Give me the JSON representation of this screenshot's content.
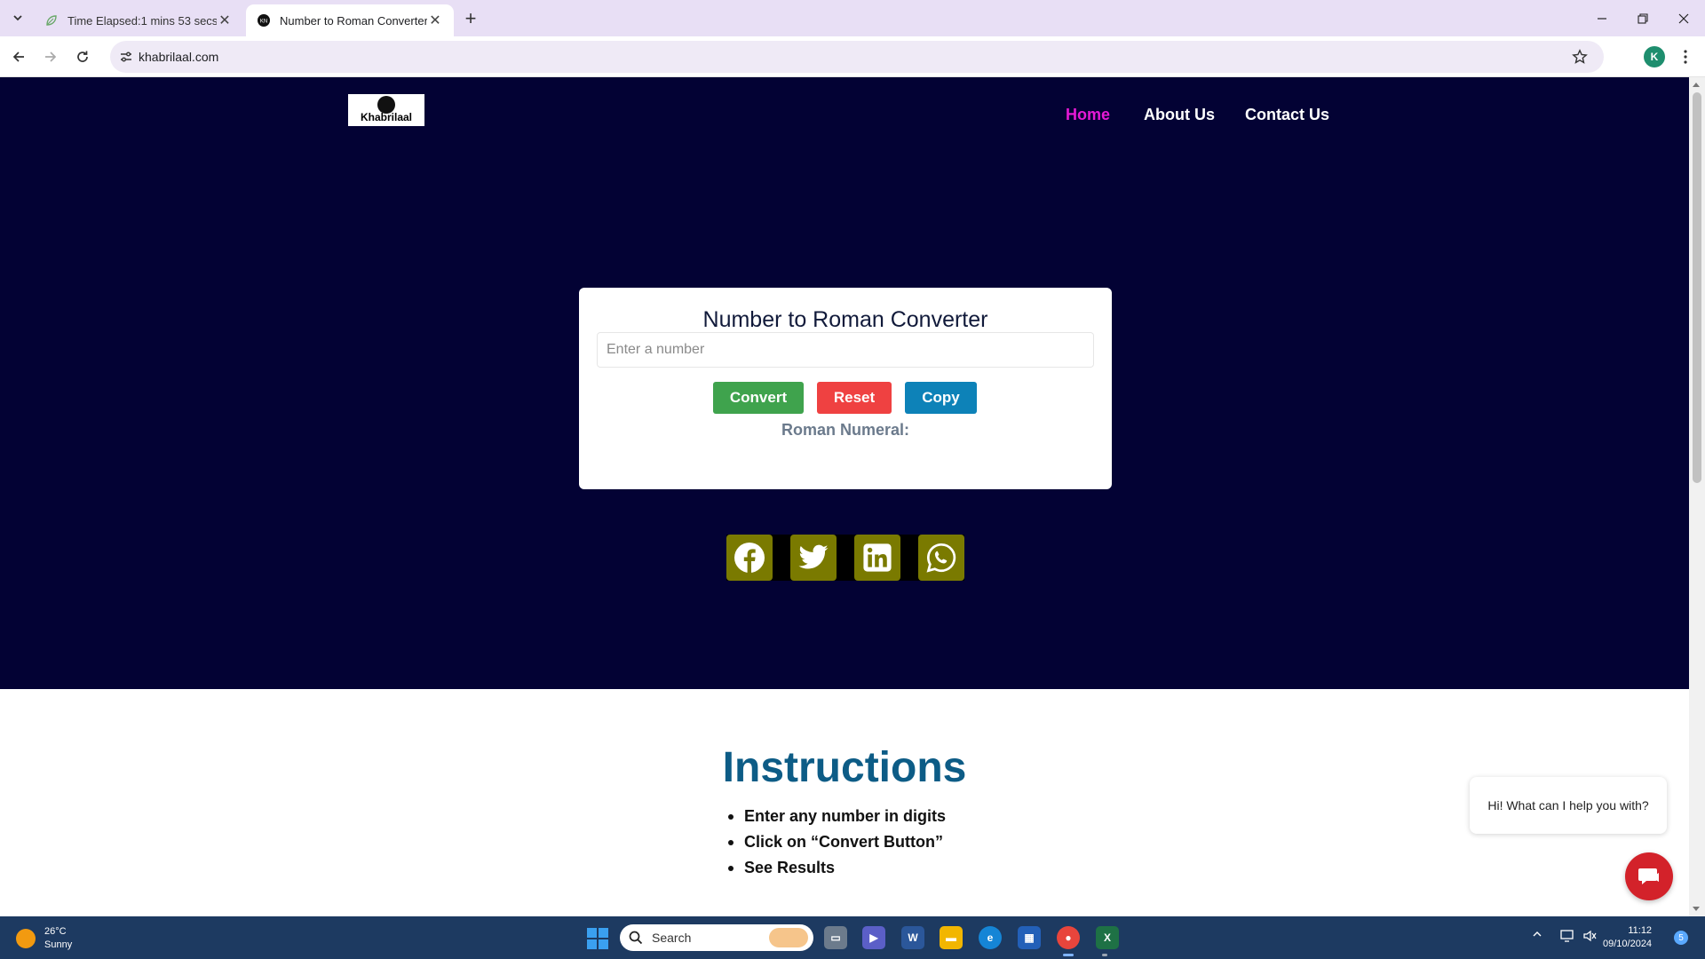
{
  "browser": {
    "tabs": [
      {
        "title": "Time Elapsed:1 mins 53 secs",
        "active": false
      },
      {
        "title": "Number to Roman Converter -",
        "active": true
      }
    ],
    "url": "khabrilaal.com",
    "profile_initial": "K"
  },
  "site": {
    "logo_text": "Khabrilaal",
    "nav": {
      "home": "Home",
      "about": "About Us",
      "contact": "Contact Us"
    },
    "colors": {
      "hero_bg": "#030234",
      "nav_active": "#e619d6",
      "social_bg": "#7a7a00"
    }
  },
  "converter": {
    "title": "Number to Roman Converter",
    "input_placeholder": "Enter a number",
    "input_value": "",
    "convert_label": "Convert",
    "reset_label": "Reset",
    "copy_label": "Copy",
    "result_label": "Roman Numeral:",
    "colors": {
      "convert": "#3fa34d",
      "reset": "#ef4141",
      "copy": "#0d82b8"
    }
  },
  "social": [
    "facebook-icon",
    "twitter-icon",
    "linkedin-icon",
    "whatsapp-icon"
  ],
  "instructions": {
    "heading": "Instructions",
    "steps": [
      "Enter any number in digits",
      "Click on “Convert Button”",
      "See Results"
    ]
  },
  "chat": {
    "greeting": "Hi! What can I help you with?"
  },
  "taskbar": {
    "weather_temp": "26°C",
    "weather_desc": "Sunny",
    "search_label": "Search",
    "time": "11:12",
    "date": "09/10/2024",
    "notifications": "5"
  }
}
